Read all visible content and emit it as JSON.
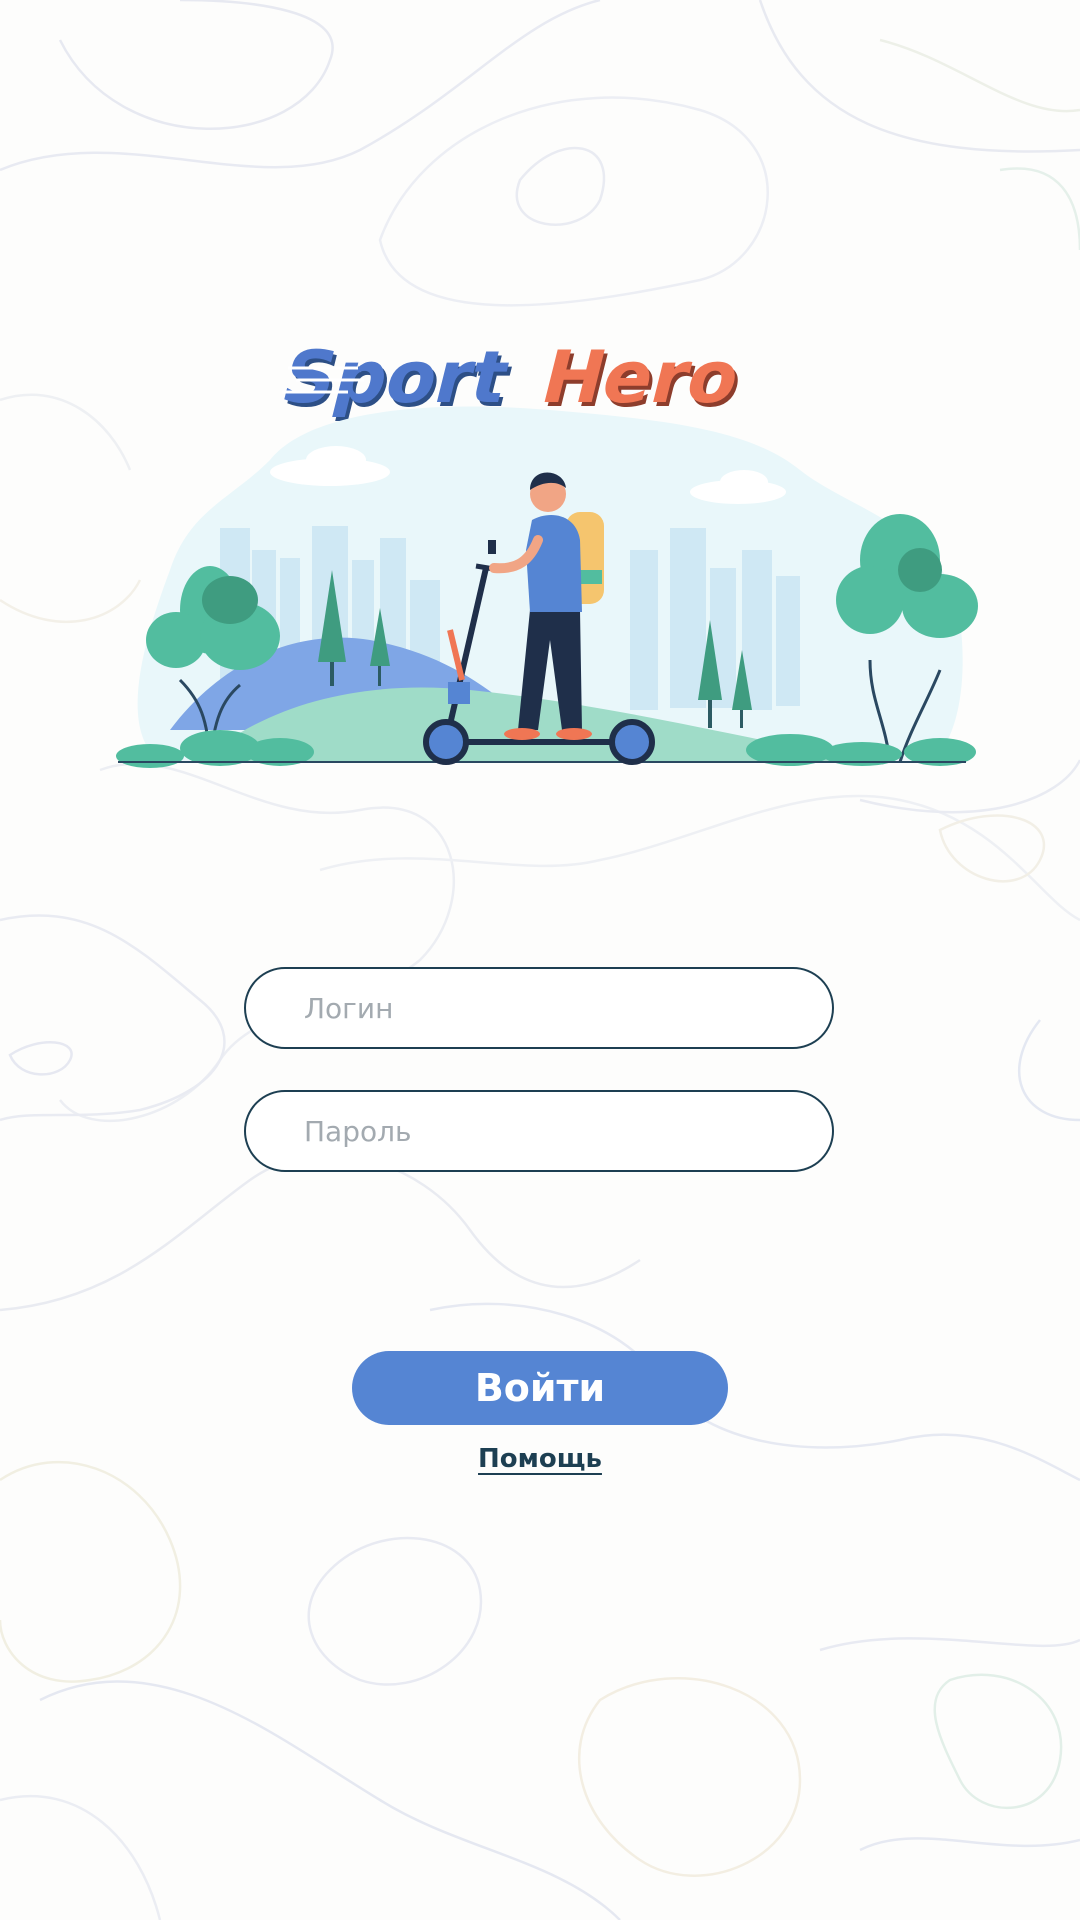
{
  "app": {
    "logo_text_part1": "Sport",
    "logo_text_part2": "Hero"
  },
  "form": {
    "login_placeholder": "Логин",
    "login_value": "",
    "password_placeholder": "Пароль",
    "password_value": "",
    "submit_label": "Войти",
    "help_label": "Помощь"
  },
  "icons": {
    "background": "topographic-lines-pattern",
    "illustration": "man-on-kick-scooter-in-park-illustration",
    "logo": "sport-hero-logo"
  },
  "colors": {
    "accent": "#5585d3",
    "field_border": "#1d3f52",
    "logo_blue": "#4f78cc",
    "logo_orange": "#f07654",
    "background": "#fdfdfc"
  }
}
